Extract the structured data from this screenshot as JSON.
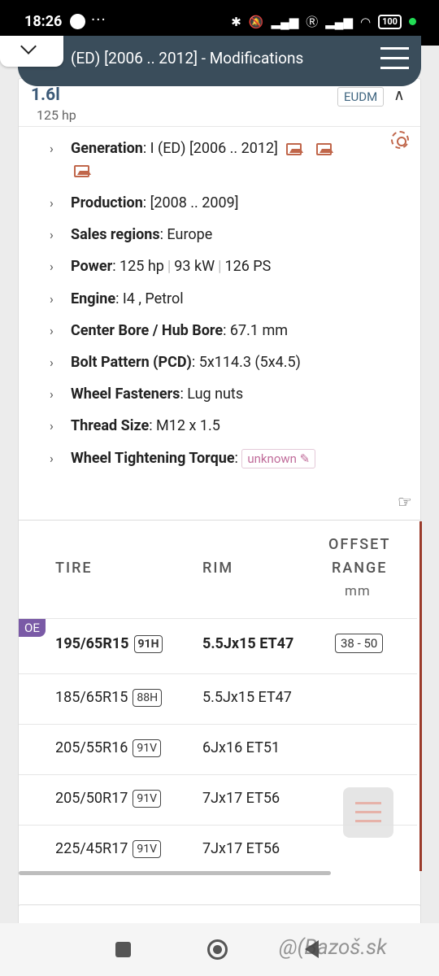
{
  "status": {
    "time": "18:26",
    "battery": "100"
  },
  "header": {
    "title": "(ED) [2006 .. 2012] - Modifications"
  },
  "engine": {
    "name": "1.6l",
    "hp": "125 hp",
    "region_badge": "EUDM"
  },
  "specs": {
    "generation_label": "Generation",
    "generation_value": ": I (ED) [2006 .. 2012]",
    "production_label": "Production",
    "production_value": ": [2008 .. 2009]",
    "sales_label": "Sales regions",
    "sales_value": ": Europe",
    "power_label": "Power",
    "power_value1": ": 125 hp",
    "power_value2": "93 kW",
    "power_value3": "126 PS",
    "engine_label": "Engine",
    "engine_value": ": I4 , Petrol",
    "bore_label": "Center Bore / Hub Bore",
    "bore_value": ": 67.1 mm",
    "pcd_label": "Bolt Pattern (PCD)",
    "pcd_value": ": 5x114.3 (5x4.5)",
    "fasteners_label": "Wheel Fasteners",
    "fasteners_value": ": Lug nuts",
    "thread_label": "Thread Size",
    "thread_value": ": M12 x 1.5",
    "torque_label": "Wheel Tightening Torque",
    "torque_sep": ":",
    "torque_value": "unknown"
  },
  "table": {
    "col_tire": "TIRE",
    "col_rim": "RIM",
    "col_offset_1": "OFFSET",
    "col_offset_2": "RANGE",
    "col_offset_unit": "mm",
    "oe_label": "OE",
    "rows": [
      {
        "tire": "195/65R15",
        "load": "91H",
        "rim": "5.5Jx15 ET47",
        "offset": "38 - 50"
      },
      {
        "tire": "185/65R15",
        "load": "88H",
        "rim": "5.5Jx15 ET47",
        "offset": ""
      },
      {
        "tire": "205/55R16",
        "load": "91V",
        "rim": "6Jx16 ET51",
        "offset": ""
      },
      {
        "tire": "205/50R17",
        "load": "91V",
        "rim": "7Jx17 ET56",
        "offset": ""
      },
      {
        "tire": "225/45R17",
        "load": "91V",
        "rim": "7Jx17 ET56",
        "offset": ""
      }
    ]
  },
  "watermark": "@(Bazoš.sk"
}
